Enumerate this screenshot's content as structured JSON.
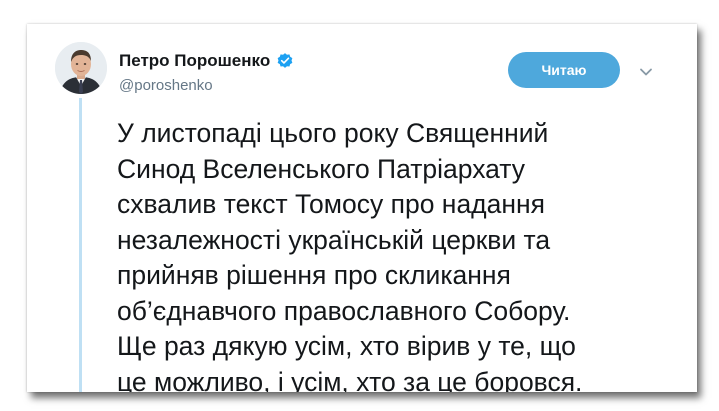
{
  "tweet": {
    "author_name": "Петро Порошенко",
    "handle": "@poroshenko",
    "follow_label": "Читаю",
    "text": "У листопаді цього року Священний\nСинод Вселенського Патріархату\nсхвалив текст Томосу про надання\nнезалежності українській церкви та\nприйняв рішення про скликання\nоб’єднавчого православного Собору.\nЩе раз дякую усім, хто вірив у те, що\nце можливо, і усім, хто за це боровся."
  },
  "icons": {
    "verified": "verified-badge-icon",
    "caret": "chevron-down-icon"
  },
  "colors": {
    "follow_button": "#4ea8dc",
    "verified": "#1da1f2",
    "thread_line": "#bfe0f4",
    "handle": "#657786",
    "text": "#14171a"
  }
}
